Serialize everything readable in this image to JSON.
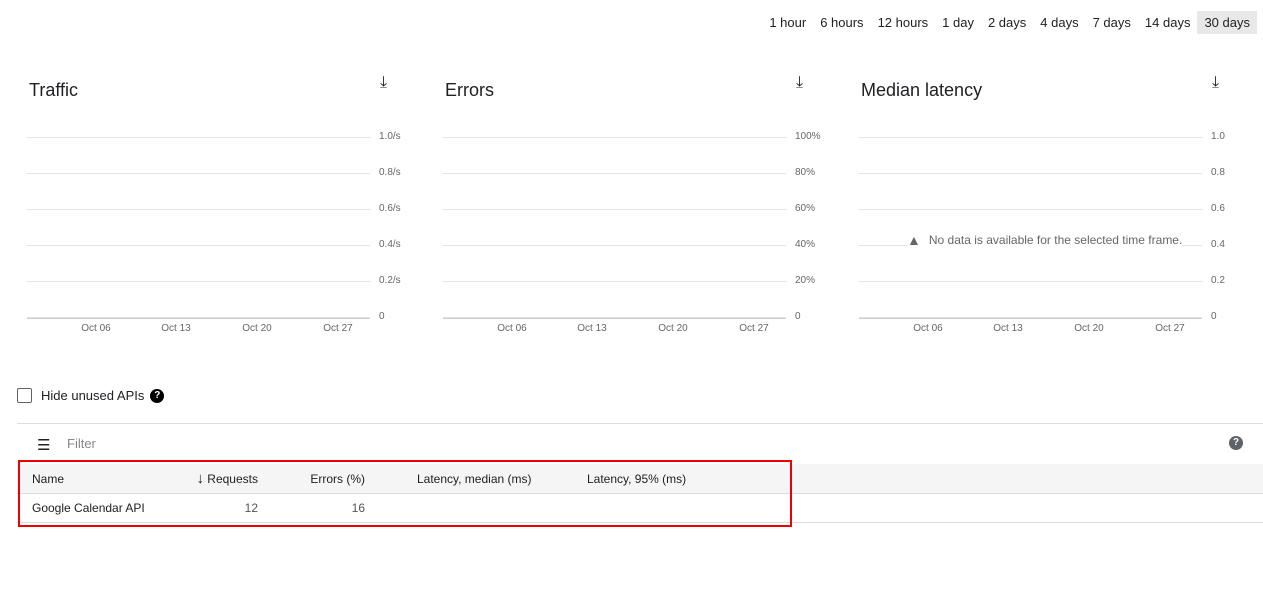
{
  "time_ranges": [
    "1 hour",
    "6 hours",
    "12 hours",
    "1 day",
    "2 days",
    "4 days",
    "7 days",
    "14 days",
    "30 days"
  ],
  "selected_range": "30 days",
  "charts": [
    {
      "title": "Traffic",
      "y_ticks": [
        "1.0/s",
        "0.8/s",
        "0.6/s",
        "0.4/s",
        "0.2/s",
        "0"
      ],
      "x_ticks": [
        "Oct 06",
        "Oct 13",
        "Oct 20",
        "Oct 27"
      ],
      "message": ""
    },
    {
      "title": "Errors",
      "y_ticks": [
        "100%",
        "80%",
        "60%",
        "40%",
        "20%",
        "0"
      ],
      "x_ticks": [
        "Oct 06",
        "Oct 13",
        "Oct 20",
        "Oct 27"
      ],
      "message": ""
    },
    {
      "title": "Median latency",
      "y_ticks": [
        "1.0",
        "0.8",
        "0.6",
        "0.4",
        "0.2",
        "0"
      ],
      "x_ticks": [
        "Oct 06",
        "Oct 13",
        "Oct 20",
        "Oct 27"
      ],
      "message": "No data is available for the selected time frame."
    }
  ],
  "hide_unused_label": "Hide unused APIs",
  "filter_placeholder": "Filter",
  "table": {
    "columns": [
      "Name",
      "Requests",
      "Errors (%)",
      "Latency, median (ms)",
      "Latency, 95% (ms)"
    ],
    "rows": [
      {
        "name": "Google Calendar API",
        "requests": "12",
        "errors": "16",
        "lat_median": "",
        "lat_95": ""
      }
    ]
  },
  "highlight_color": "#e00000"
}
